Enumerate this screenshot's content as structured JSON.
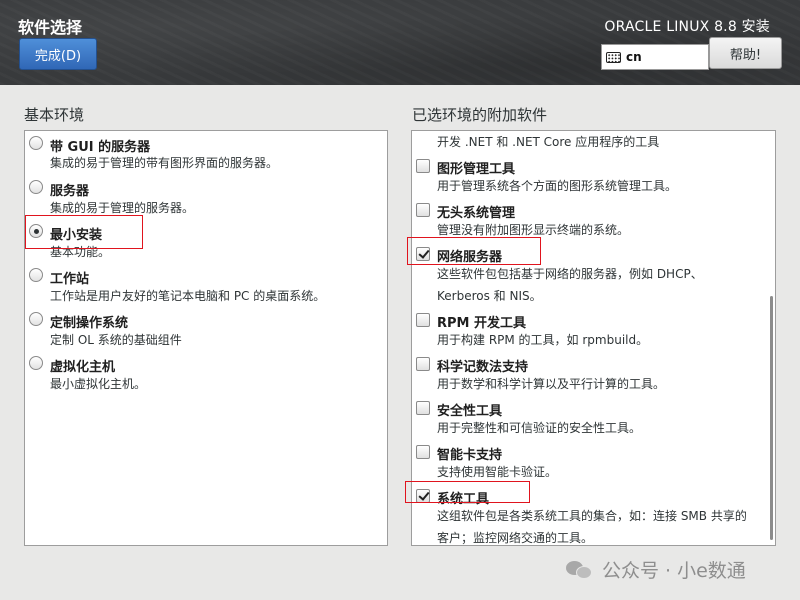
{
  "header": {
    "spoke_title": "软件选择",
    "done_button": "完成(D)",
    "product": "ORACLE LINUX 8.8 安装",
    "keyboard_layout": "cn",
    "help_button": "帮助!"
  },
  "base_env": {
    "title": "基本环境",
    "options": [
      {
        "name": "带 GUI 的服务器",
        "desc": "集成的易于管理的带有图形界面的服务器。",
        "selected": false
      },
      {
        "name": "服务器",
        "desc": "集成的易于管理的服务器。",
        "selected": false
      },
      {
        "name": "最小安装",
        "desc": "基本功能。",
        "selected": true
      },
      {
        "name": "工作站",
        "desc": "工作站是用户友好的笔记本电脑和 PC 的桌面系统。",
        "selected": false
      },
      {
        "name": "定制操作系统",
        "desc": "定制 OL 系统的基础组件",
        "selected": false
      },
      {
        "name": "虚拟化主机",
        "desc": "最小虚拟化主机。",
        "selected": false
      }
    ]
  },
  "addons": {
    "title": "已选环境的附加软件",
    "partial_top_desc": "开发 .NET 和 .NET Core 应用程序的工具",
    "items": [
      {
        "name": "图形管理工具",
        "desc": [
          "用于管理系统各个方面的图形系统管理工具。"
        ],
        "checked": false
      },
      {
        "name": "无头系统管理",
        "desc": [
          "管理没有附加图形显示终端的系统。"
        ],
        "checked": false
      },
      {
        "name": "网络服务器",
        "desc": [
          "这些软件包包括基于网络的服务器，例如 DHCP、",
          "Kerberos 和 NIS。"
        ],
        "checked": true
      },
      {
        "name": "RPM 开发工具",
        "desc": [
          "用于构建 RPM 的工具，如 rpmbuild。"
        ],
        "checked": false
      },
      {
        "name": "科学记数法支持",
        "desc": [
          "用于数学和科学计算以及平行计算的工具。"
        ],
        "checked": false
      },
      {
        "name": "安全性工具",
        "desc": [
          "用于完整性和可信验证的安全性工具。"
        ],
        "checked": false
      },
      {
        "name": "智能卡支持",
        "desc": [
          "支持使用智能卡验证。"
        ],
        "checked": false
      },
      {
        "name": "系统工具",
        "desc": [
          "这组软件包是各类系统工具的集合，如：连接 SMB 共享的",
          "客户；监控网络交通的工具。"
        ],
        "checked": true
      }
    ]
  },
  "watermark": {
    "text": "公众号 · 小e数通"
  }
}
